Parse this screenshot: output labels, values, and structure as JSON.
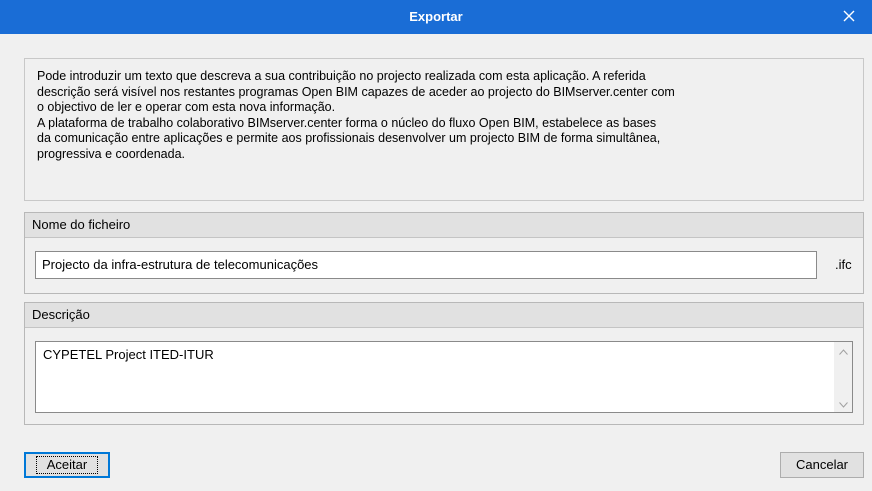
{
  "window": {
    "title": "Exportar",
    "close_icon": "close-icon"
  },
  "info": {
    "text": "Pode introduzir um texto que descreva a sua contribuição no projecto realizada com esta aplicação. A referida\ndescrição será visível nos restantes programas Open BIM capazes de aceder ao projecto do BIMserver.center com\no objectivo de ler e operar com esta nova informação.\nA plataforma de trabalho colaborativo BIMserver.center forma o núcleo do fluxo Open BIM, estabelece as bases\nda comunicação entre aplicações e permite aos profissionais desenvolver um projecto BIM de forma simultânea,\nprogressiva e coordenada."
  },
  "filename": {
    "header": "Nome do ficheiro",
    "value": "Projecto da infra-estrutura de telecomunicações",
    "extension": ".ifc"
  },
  "description": {
    "header": "Descrição",
    "value": "CYPETEL Project ITED-ITUR"
  },
  "buttons": {
    "accept": "Aceitar",
    "cancel": "Cancelar"
  },
  "colors": {
    "titlebar": "#1a6dd6",
    "dialog_bg": "#f0f0f0",
    "focus_border": "#0078d7"
  }
}
